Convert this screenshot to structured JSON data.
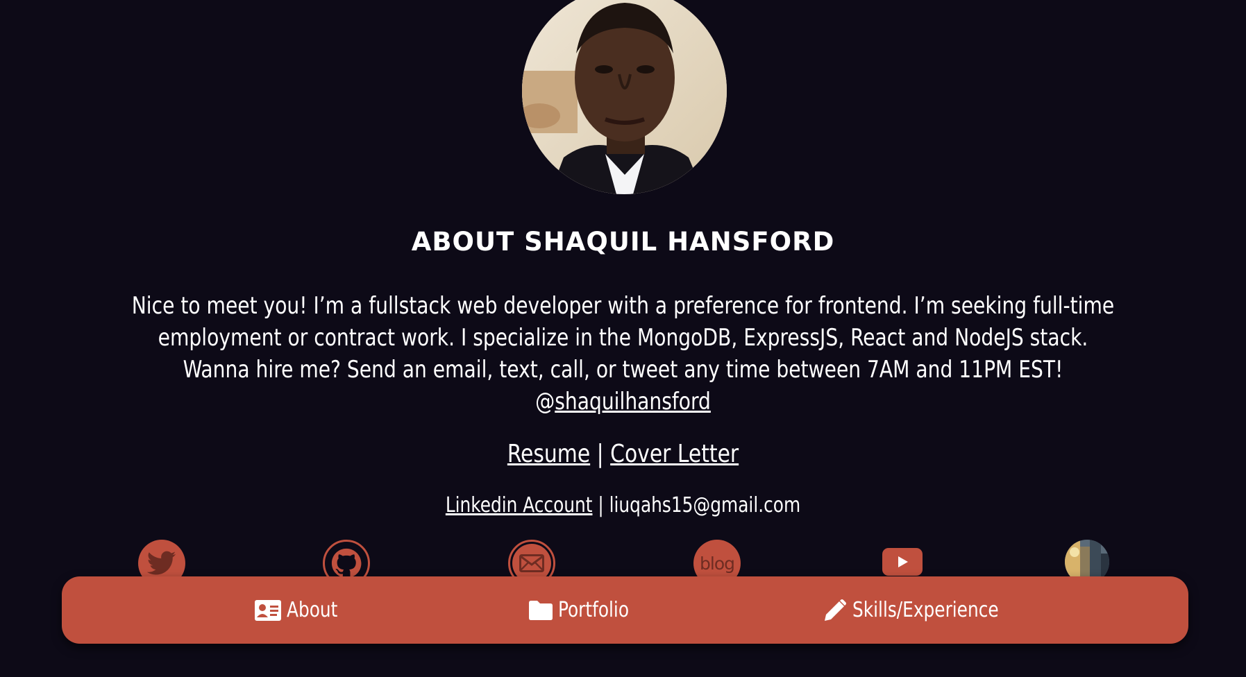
{
  "profile": {
    "avatar_alt": "profile-photo"
  },
  "about": {
    "title": "ABOUT SHAQUIL HANSFORD",
    "bio_line1": "Nice to meet you! I’m a fullstack web developer with a preference for frontend. I’m seeking full-time",
    "bio_line2": "employment or contract work. I specialize in the MongoDB, ExpressJS, React and NodeJS stack.",
    "bio_line3": "Wanna hire me? Send an email, text, call, or tweet any time between 7AM and 11PM EST!",
    "twitter_at": "@",
    "twitter_handle": "shaquilhansford"
  },
  "docs": {
    "resume": "Resume",
    "separator": "|",
    "cover_letter": "Cover Letter"
  },
  "contact": {
    "linkedin": "Linkedin Account",
    "separator": "|",
    "email": "liuqahs15@gmail.com"
  },
  "social": {
    "icons": [
      "twitter-icon",
      "github-icon",
      "email-icon",
      "blog-icon",
      "youtube-icon",
      "instagram-icon"
    ],
    "blog_label": "blog"
  },
  "nav": {
    "about": "About",
    "portfolio": "Portfolio",
    "skills": "Skills/Experience"
  },
  "colors": {
    "background": "#0d0a17",
    "accent": "#c0503e",
    "text": "#ffffff"
  }
}
